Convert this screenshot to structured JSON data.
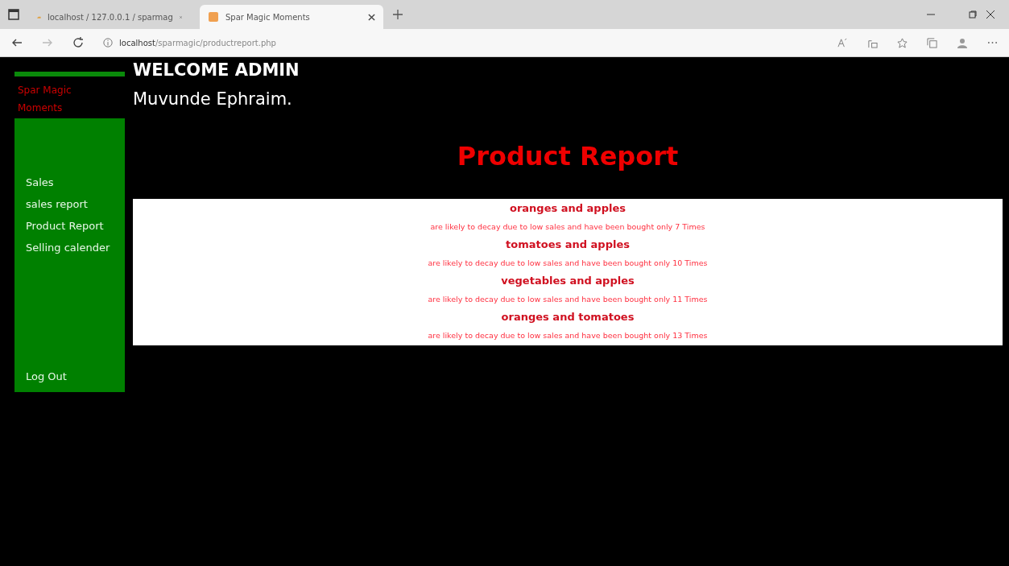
{
  "browser": {
    "tabs": [
      {
        "title": "localhost / 127.0.0.1 / sparmag",
        "selected": false
      },
      {
        "title": "Spar Magic Moments",
        "selected": true
      }
    ],
    "address": {
      "host": "localhost",
      "path": "/sparmagic/productreport.php"
    }
  },
  "sidebar": {
    "brand": "Spar Magic Moments",
    "items": [
      {
        "label": "Sales"
      },
      {
        "label": "sales report"
      },
      {
        "label": "Product Report"
      },
      {
        "label": "Selling calender"
      }
    ],
    "logout": "Log Out"
  },
  "header": {
    "welcome": "WELCOME ADMIN",
    "user": "Muvunde Ephraim."
  },
  "title": "Product Report",
  "report": [
    {
      "product": "oranges and apples",
      "note": "are likely to decay due to low sales and have been bought only 7 Times"
    },
    {
      "product": "tomatoes and apples",
      "note": "are likely to decay due to low sales and have been bought only 10 Times"
    },
    {
      "product": "vegetables and apples",
      "note": "are likely to decay due to low sales and have been bought only 11 Times"
    },
    {
      "product": "oranges and tomatoes",
      "note": "are likely to decay due to low sales and have been bought only 13 Times"
    }
  ]
}
